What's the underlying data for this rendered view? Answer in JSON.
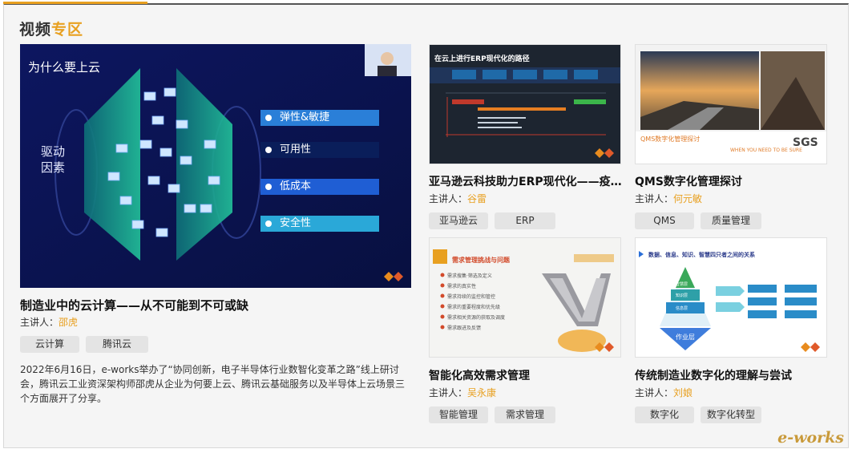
{
  "section": {
    "title_a": "视频",
    "title_b": "专区"
  },
  "featured": {
    "slide": {
      "heading": "为什么要上云",
      "driver_line1": "驱动",
      "driver_line2": "因素",
      "benefits": [
        "弹性&敏捷",
        "可用性",
        "低成本",
        "安全性"
      ]
    },
    "title": "制造业中的云计算——从不可能到不可或缺",
    "speaker_label": "主讲人：",
    "speaker": "邵虎",
    "tags": [
      "云计算",
      "腾讯云"
    ],
    "description": "2022年6月16日，e-works举办了“协同创新，电子半导体行业数智化变革之路”线上研讨会，腾讯云工业资深架构师邵虎从企业为何要上云、腾讯云基础服务以及半导体上云场景三个方面展开了分享。"
  },
  "cards": [
    {
      "slide_heading": "在云上进行ERP现代化的路径",
      "title": "亚马逊云科技助力ERP现代化——疫情...",
      "speaker_label": "主讲人：",
      "speaker": "谷雷",
      "tags": [
        "亚马逊云",
        "ERP"
      ]
    },
    {
      "slide_heading": "QMS数字化管理探讨",
      "slide_note": "WHEN YOU NEED TO BE SURE",
      "slide_logo": "SGS",
      "title": "QMS数字化管理探讨",
      "speaker_label": "主讲人：",
      "speaker": "何元敏",
      "tags": [
        "QMS",
        "质量管理"
      ]
    },
    {
      "slide_heading": "需求管理挑战与问题",
      "slide_items": [
        "需求搜集·筛选及定义",
        "需求的真实性",
        "需求持续的监控和管控",
        "需求的重要程度和优先级",
        "需求相关资源的获取及调度",
        "需求跟进及反馈"
      ],
      "title": "智能化高效需求管理",
      "speaker_label": "主讲人：",
      "speaker": "吴永康",
      "tags": [
        "智能管理",
        "需求管理"
      ]
    },
    {
      "slide_heading": "数据、信息、知识、智慧四只者之间的关系",
      "slide_pyramid": [
        "智慧层",
        "知识层",
        "信息层",
        "作业层"
      ],
      "title": "传统制造业数字化的理解与尝试",
      "speaker_label": "主讲人：",
      "speaker": "刘娘",
      "tags": [
        "数字化",
        "数字化转型"
      ]
    }
  ],
  "watermark": "e-works",
  "colors": {
    "accent": "#e8a020",
    "featured_bg": "#0c1250",
    "teal": "#1ca58c",
    "benefit_blue": "#2a7fd8"
  }
}
